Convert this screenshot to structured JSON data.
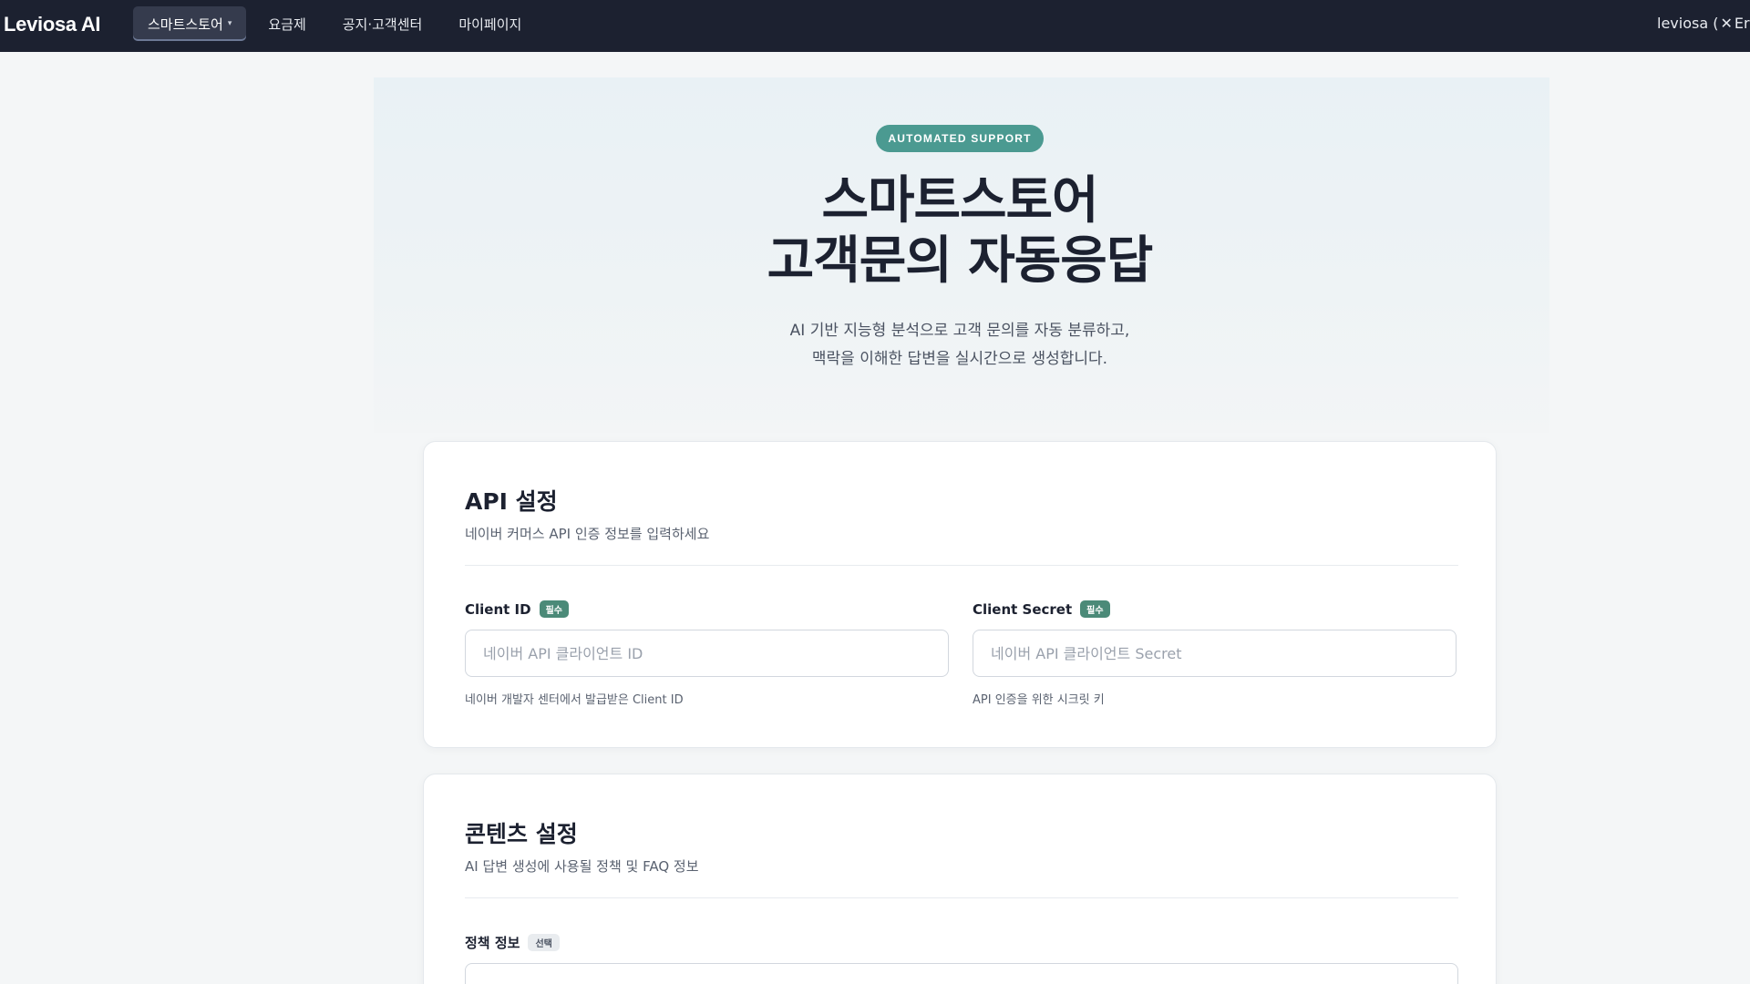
{
  "navbar": {
    "brand": "Leviosa AI",
    "items": [
      {
        "label": "스마트스토어",
        "active": true,
        "dropdown": true
      },
      {
        "label": "요금제",
        "active": false
      },
      {
        "label": "공지·고객센터",
        "active": false
      },
      {
        "label": "마이페이지",
        "active": false
      }
    ],
    "dropdown_caret": "▾",
    "user_prefix": "leviosa (",
    "user_suffix": "Er",
    "user_icon": "x-icon"
  },
  "hero": {
    "badge": "AUTOMATED SUPPORT",
    "title_line1": "스마트스토어",
    "title_line2": "고객문의 자동응답",
    "subtitle_line1": "AI 기반 지능형 분석으로 고객 문의를 자동 분류하고,",
    "subtitle_line2": "맥락을 이해한 답변을 실시간으로 생성합니다."
  },
  "api_settings": {
    "title": "API 설정",
    "description": "네이버 커머스 API 인증 정보를 입력하세요",
    "client_id": {
      "label": "Client ID",
      "badge": "필수",
      "placeholder": "네이버 API 클라이언트 ID",
      "value": "",
      "help": "네이버 개발자 센터에서 발급받은 Client ID"
    },
    "client_secret": {
      "label": "Client Secret",
      "badge": "필수",
      "placeholder": "네이버 API 클라이언트 Secret",
      "value": "",
      "help": "API 인증을 위한 시크릿 키"
    }
  },
  "content_settings": {
    "title": "콘텐츠 설정",
    "description": "AI 답변 생성에 사용될 정책 및 FAQ 정보",
    "policy": {
      "label": "정책 정보",
      "badge": "선택"
    }
  },
  "colors": {
    "navbar_bg": "#1c2130",
    "accent_teal": "#4b9a91",
    "required_badge": "#4b8a78",
    "page_bg": "#f4f6f7"
  }
}
